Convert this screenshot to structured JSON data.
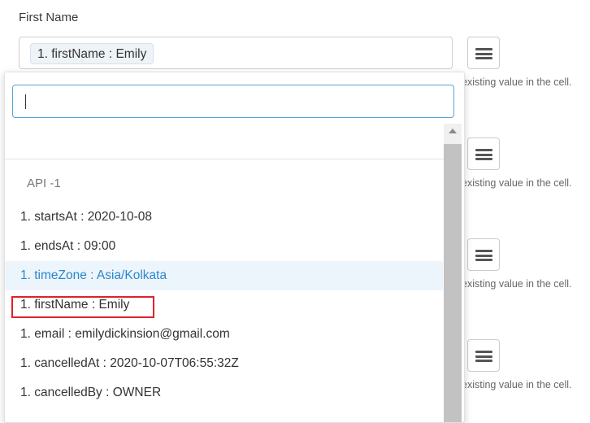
{
  "field": {
    "label": "First Name",
    "chip": "1. firstName : Emily"
  },
  "hint_text": "existing value in the cell.",
  "dropdown": {
    "search": {
      "value": "",
      "placeholder": ""
    },
    "group_label": "API -1",
    "items": [
      {
        "label": "1. startsAt : 2020-10-08"
      },
      {
        "label": "1. endsAt : 09:00"
      },
      {
        "label": "1. timeZone : Asia/Kolkata"
      },
      {
        "label": "1. firstName : Emily"
      },
      {
        "label": "1. email : emilydickinsion@gmail.com"
      },
      {
        "label": "1. cancelledAt : 2020-10-07T06:55:32Z"
      },
      {
        "label": "1. cancelledBy : OWNER"
      }
    ],
    "active_item": "1. timeZone : Asia/Kolkata",
    "highlighted_item": "1. firstName : Emily"
  },
  "icons": {
    "menu": "hamburger-menu-icon",
    "scroll_up": "triangle-up-icon"
  },
  "colors": {
    "accent": "#2b87c9",
    "active_bg": "#edf5fc",
    "highlight_border": "#e0212a",
    "focus_border": "#5aa3d6"
  }
}
